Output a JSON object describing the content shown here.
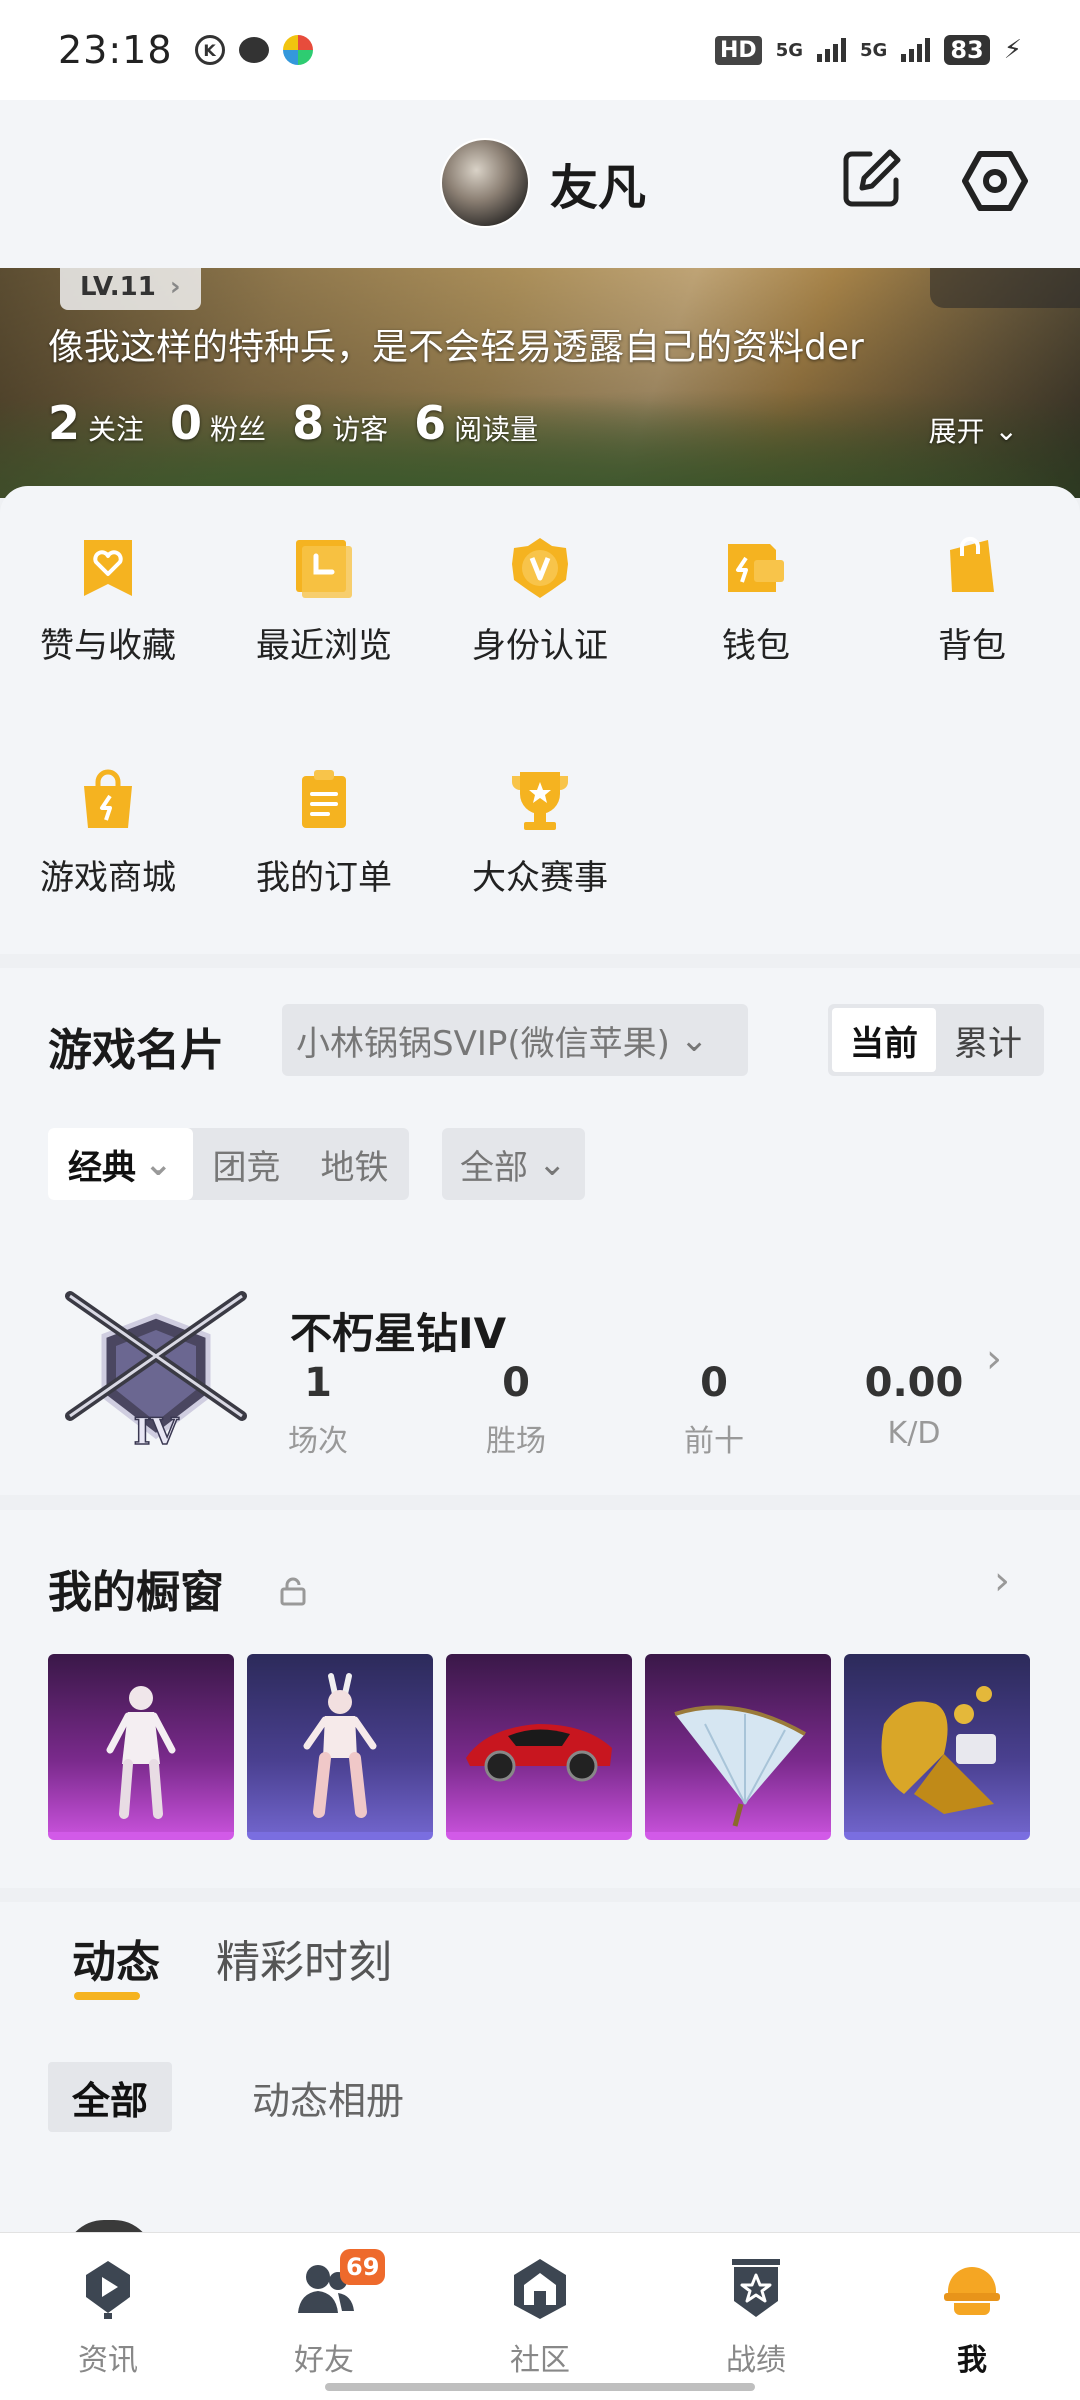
{
  "status_bar": {
    "time": "23:18",
    "left_icons": [
      "k-circle-icon",
      "chat-bubble-icon",
      "color-wheel-icon"
    ],
    "hd": "HD",
    "signal1": "5G",
    "signal2": "5G",
    "battery": "83"
  },
  "header": {
    "nickname": "友凡",
    "edit_icon": "edit-icon",
    "settings_icon": "settings-hex-icon"
  },
  "profile": {
    "level": "LV.11",
    "bio": "像我这样的特种兵，是不会轻易透露自己的资料der",
    "stats": [
      {
        "num": "2",
        "label": "关注"
      },
      {
        "num": "0",
        "label": "粉丝"
      },
      {
        "num": "8",
        "label": "访客"
      },
      {
        "num": "6",
        "label": "阅读量"
      }
    ],
    "expand": "展开"
  },
  "quick_menu": [
    {
      "label": "赞与收藏",
      "icon": "heart-ribbon-icon"
    },
    {
      "label": "最近浏览",
      "icon": "clock-folder-icon"
    },
    {
      "label": "身份认证",
      "icon": "v-badge-icon"
    },
    {
      "label": "钱包",
      "icon": "wallet-icon"
    },
    {
      "label": "背包",
      "icon": "backpack-icon"
    },
    {
      "label": "游戏商城",
      "icon": "shopping-bag-icon"
    },
    {
      "label": "我的订单",
      "icon": "clipboard-icon"
    },
    {
      "label": "大众赛事",
      "icon": "trophy-icon"
    }
  ],
  "game_card": {
    "title": "游戏名片",
    "account": "小林锅锅SVIP(微信苹果)",
    "period_tabs": [
      "当前",
      "累计"
    ],
    "mode_tabs": [
      "经典",
      "团竞",
      "地铁"
    ],
    "range": "全部",
    "rank": "不朽星钻IV",
    "rank_roman": "IV",
    "stats": [
      {
        "value": "1",
        "label": "场次"
      },
      {
        "value": "0",
        "label": "胜场"
      },
      {
        "value": "0",
        "label": "前十"
      },
      {
        "value": "0.00",
        "label": "K/D"
      }
    ]
  },
  "showcase": {
    "title": "我的橱窗",
    "items": [
      "outfit-white-dress",
      "outfit-bunny",
      "red-sports-car",
      "glider",
      "gold-armor-set"
    ]
  },
  "feed": {
    "tabs": [
      "动态",
      "精彩时刻"
    ],
    "sub_tabs": [
      "全部",
      "动态相册"
    ]
  },
  "bottom_nav": [
    {
      "label": "资讯",
      "icon": "play-pin-icon"
    },
    {
      "label": "好友",
      "icon": "friends-icon",
      "badge": "69"
    },
    {
      "label": "社区",
      "icon": "house-hex-icon"
    },
    {
      "label": "战绩",
      "icon": "star-shield-icon"
    },
    {
      "label": "我",
      "icon": "helmet-icon"
    }
  ],
  "colors": {
    "accent": "#f5b320",
    "badge": "#ee6a2c",
    "showcase_purple": "#c34fd6",
    "showcase_blue": "#6f63c9"
  }
}
